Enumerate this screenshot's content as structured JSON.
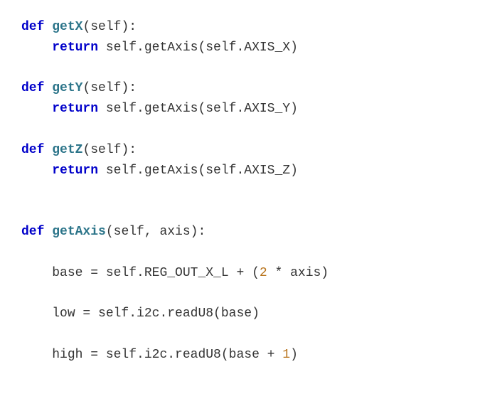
{
  "code": {
    "lines": [
      {
        "indent": 0,
        "segments": [
          {
            "t": "def ",
            "c": "kw"
          },
          {
            "t": "getX",
            "c": "fn"
          },
          {
            "t": "(self):",
            "c": "txt"
          }
        ]
      },
      {
        "indent": 1,
        "segments": [
          {
            "t": "return",
            "c": "kw"
          },
          {
            "t": " self.getAxis(self.AXIS_X)",
            "c": "txt"
          }
        ]
      },
      {
        "indent": 0,
        "segments": []
      },
      {
        "indent": 0,
        "segments": [
          {
            "t": "def ",
            "c": "kw"
          },
          {
            "t": "getY",
            "c": "fn"
          },
          {
            "t": "(self):",
            "c": "txt"
          }
        ]
      },
      {
        "indent": 1,
        "segments": [
          {
            "t": "return",
            "c": "kw"
          },
          {
            "t": " self.getAxis(self.AXIS_Y)",
            "c": "txt"
          }
        ]
      },
      {
        "indent": 0,
        "segments": []
      },
      {
        "indent": 0,
        "segments": [
          {
            "t": "def ",
            "c": "kw"
          },
          {
            "t": "getZ",
            "c": "fn"
          },
          {
            "t": "(self):",
            "c": "txt"
          }
        ]
      },
      {
        "indent": 1,
        "segments": [
          {
            "t": "return",
            "c": "kw"
          },
          {
            "t": " self.getAxis(self.AXIS_Z)",
            "c": "txt"
          }
        ]
      },
      {
        "indent": 0,
        "segments": []
      },
      {
        "indent": 0,
        "segments": []
      },
      {
        "indent": 0,
        "segments": [
          {
            "t": "def ",
            "c": "kw"
          },
          {
            "t": "getAxis",
            "c": "fn"
          },
          {
            "t": "(self, axis):",
            "c": "txt"
          }
        ]
      },
      {
        "indent": 0,
        "segments": []
      },
      {
        "indent": 1,
        "segments": [
          {
            "t": "base = self.REG_OUT_X_L + (",
            "c": "txt"
          },
          {
            "t": "2",
            "c": "num"
          },
          {
            "t": " * axis)",
            "c": "txt"
          }
        ]
      },
      {
        "indent": 0,
        "segments": []
      },
      {
        "indent": 1,
        "segments": [
          {
            "t": "low = self.i2c.readU8(base)",
            "c": "txt"
          }
        ]
      },
      {
        "indent": 0,
        "segments": []
      },
      {
        "indent": 1,
        "segments": [
          {
            "t": "high = self.i2c.readU8(base + ",
            "c": "txt"
          },
          {
            "t": "1",
            "c": "num"
          },
          {
            "t": ")",
            "c": "txt"
          }
        ]
      }
    ]
  }
}
